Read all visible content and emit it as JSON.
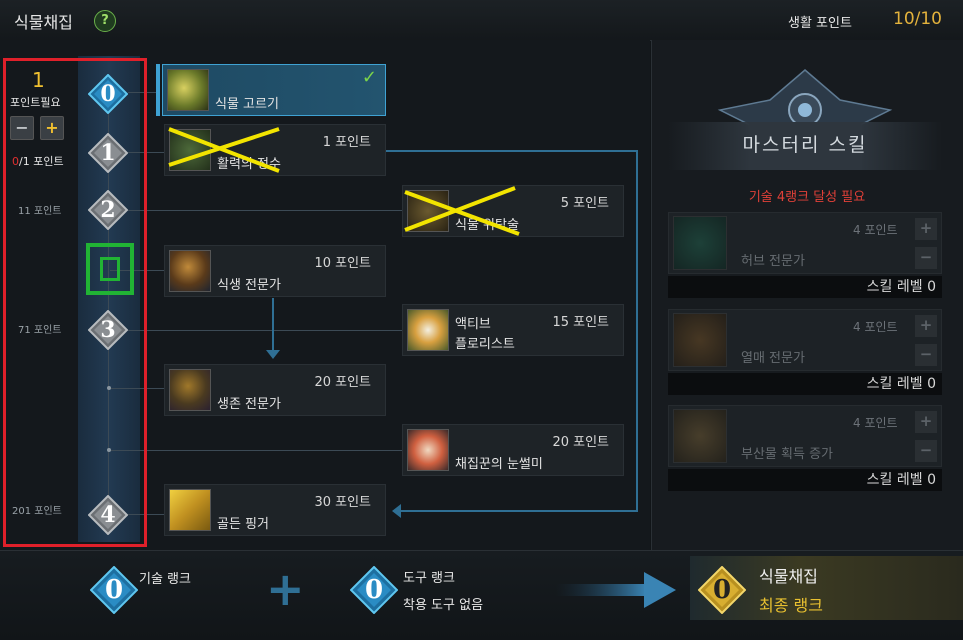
{
  "header": {
    "title": "식물채집",
    "help_glyph": "?",
    "life_points_label": "생활 포인트",
    "life_points_value": "10/10"
  },
  "rank_panel": {
    "points_required_value": "1",
    "points_required_label": "포인트필요",
    "minus_glyph": "−",
    "plus_glyph": "+",
    "points_have_current": "0",
    "points_have_rest": "/1 포인트",
    "tiers": [
      {
        "rank": "0",
        "requirement": ""
      },
      {
        "rank": "1",
        "requirement": ""
      },
      {
        "rank": "2",
        "requirement": "11 포인트"
      },
      {
        "rank": "3",
        "requirement": "71 포인트"
      },
      {
        "rank": "4",
        "requirement": "201 포인트"
      }
    ]
  },
  "skills": [
    {
      "name": "식물 고르기",
      "cost": "",
      "selected": true,
      "crossed_out": false,
      "icon": "harvesting-figure-icon"
    },
    {
      "name": "활력의 정수",
      "cost": "1 포인트",
      "selected": false,
      "crossed_out": true,
      "icon": "vitality-icon"
    },
    {
      "name": "식물 위탁술",
      "cost": "5 포인트",
      "selected": false,
      "crossed_out": true,
      "icon": "plant-entrust-icon"
    },
    {
      "name": "식생 전문가",
      "cost": "10 포인트",
      "selected": false,
      "crossed_out": false,
      "icon": "mushroom-icon"
    },
    {
      "name_line1": "액티브",
      "name": "플로리스트",
      "cost": "15 포인트",
      "selected": false,
      "crossed_out": false,
      "icon": "flower-icon"
    },
    {
      "name": "생존 전문가",
      "cost": "20 포인트",
      "selected": false,
      "crossed_out": false,
      "icon": "survival-mushroom-icon"
    },
    {
      "name": "채집꾼의 눈썰미",
      "cost": "20 포인트",
      "selected": false,
      "crossed_out": false,
      "icon": "leaf-eye-icon"
    },
    {
      "name": "골든 핑거",
      "cost": "30 포인트",
      "selected": false,
      "crossed_out": false,
      "icon": "golden-finger-icon"
    }
  ],
  "mastery": {
    "title": "마스터리 스킬",
    "requirement": "기술 4랭크 달성 필요",
    "skills": [
      {
        "name": "허브 전문가",
        "cost": "4 포인트",
        "level_label": "스킬 레벨 0",
        "icon": "herb-icon"
      },
      {
        "name": "열매 전문가",
        "cost": "4 포인트",
        "level_label": "스킬 레벨 0",
        "icon": "fruit-icon"
      },
      {
        "name": "부산물 획득 증가",
        "cost": "4 포인트",
        "level_label": "스킬 레벨 0",
        "icon": "byproduct-icon"
      }
    ],
    "plus_glyph": "+",
    "minus_glyph": "−"
  },
  "bottom": {
    "skill_rank_value": "0",
    "skill_rank_label": "기술 랭크",
    "plus_glyph": "+",
    "tool_rank_value": "0",
    "tool_rank_label": "도구 랭크",
    "tool_rank_sub": "착용 도구 없음",
    "final_rank_value": "0",
    "final_title": "식물채집",
    "final_sub": "최종 랭크"
  },
  "colors": {
    "accent_blue": "#3fa2d3",
    "gold": "#f0c030",
    "warning_red": "#e04038",
    "annotation_red": "#e0202a",
    "annotation_green": "#21b334",
    "annotation_x": "#f2e400"
  }
}
